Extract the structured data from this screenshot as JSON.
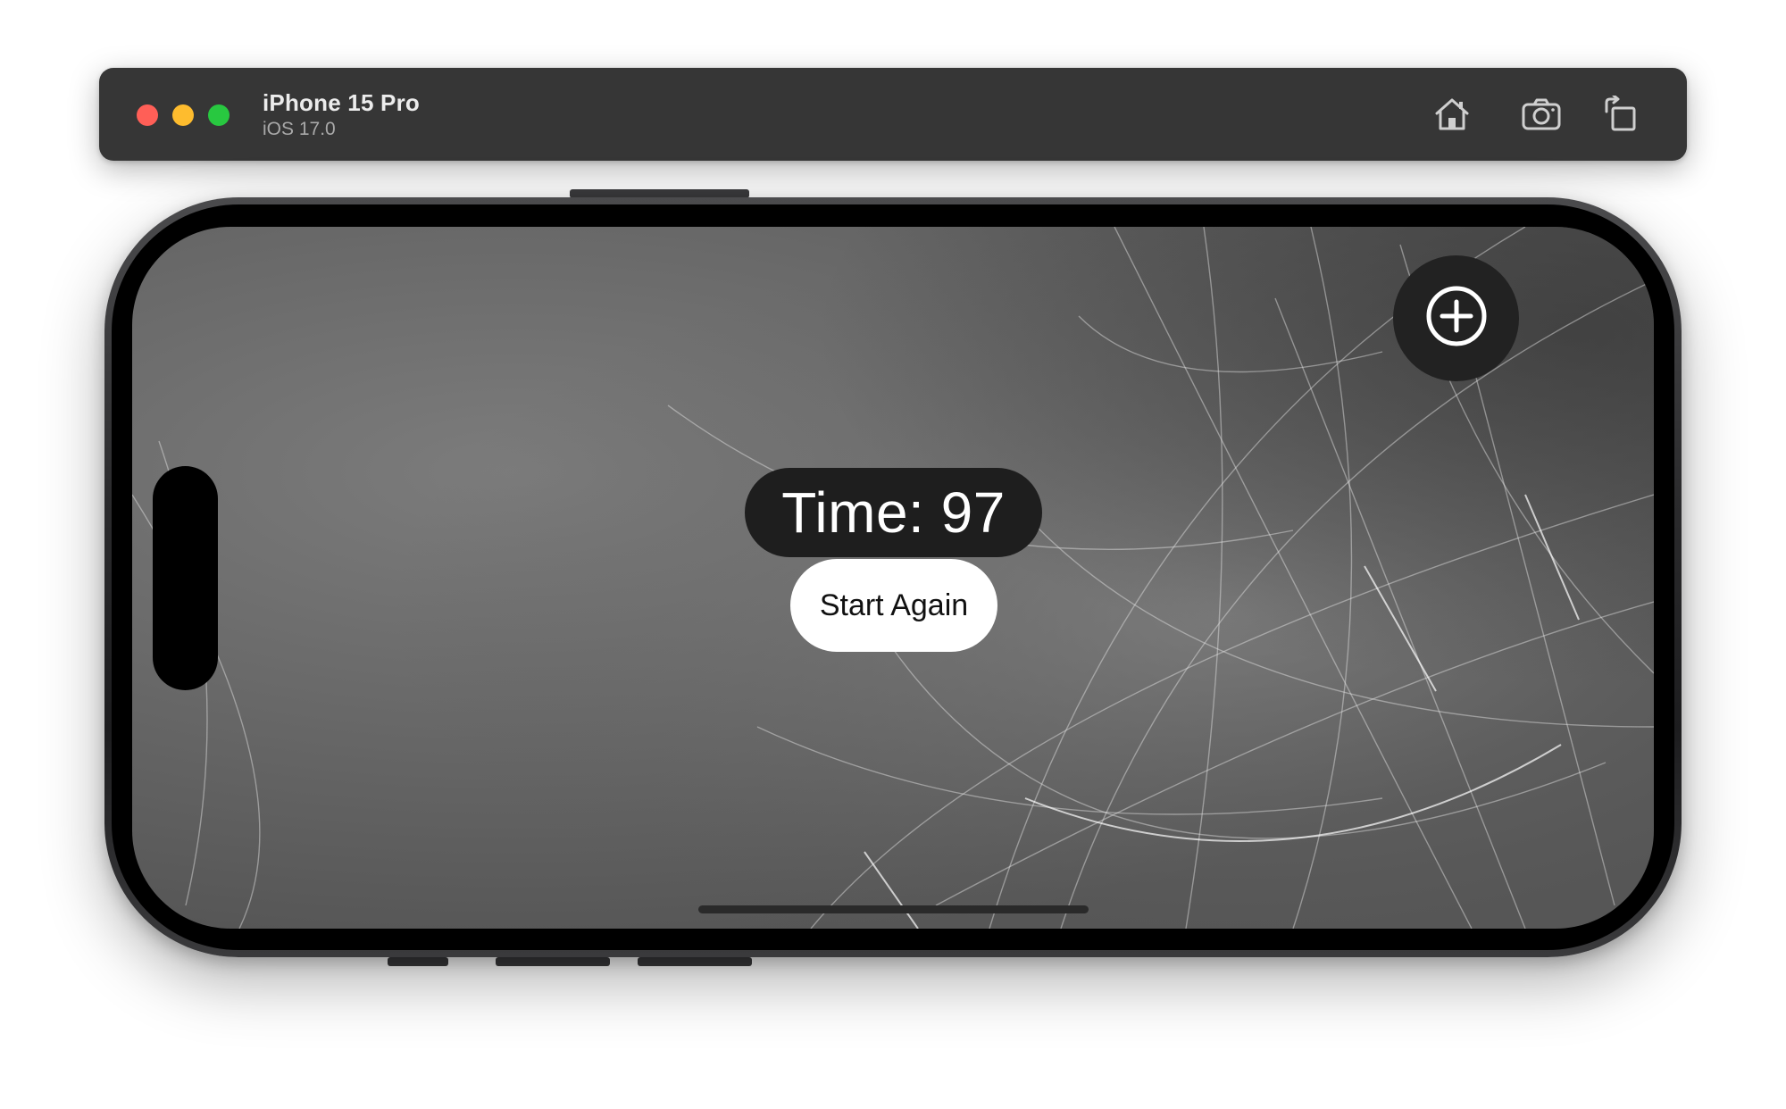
{
  "simulator": {
    "device_name": "iPhone 15 Pro",
    "os_version": "iOS 17.0",
    "toolbar": {
      "home_icon": "home-icon",
      "screenshot_icon": "camera-icon",
      "rotate_icon": "rotate-icon"
    },
    "traffic_lights": {
      "close_color": "#ff5f57",
      "minimize_color": "#febc2e",
      "zoom_color": "#28c840"
    }
  },
  "app": {
    "timer_text": "Time: 97",
    "start_again_label": "Start Again",
    "add_button_icon": "plus-circle-icon",
    "background": "scratched-metal-texture"
  }
}
